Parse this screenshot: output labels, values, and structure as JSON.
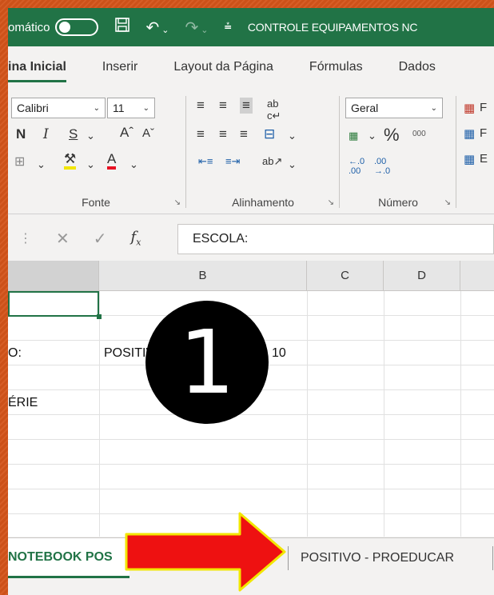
{
  "titlebar": {
    "autosave_label": "omático",
    "doc_title": "CONTROLE EQUIPAMENTOS NC"
  },
  "tabs": [
    "ina Inicial",
    "Inserir",
    "Layout da Página",
    "Fórmulas",
    "Dados"
  ],
  "ribbon": {
    "font_name": "Calibri",
    "font_size": "11",
    "number_format": "Geral",
    "groups": {
      "font": "Fonte",
      "alignment": "Alinhamento",
      "number": "Número"
    },
    "styles_letters": [
      "F",
      "F",
      "E"
    ]
  },
  "formula_bar": {
    "value": "ESCOLA:"
  },
  "grid": {
    "columns": [
      "",
      "B",
      "C",
      "D",
      ""
    ],
    "cells": {
      "a3": "O:",
      "b3": "POSITIV",
      "b3_tail": "10",
      "a5": "ÉRIE"
    }
  },
  "sheets": {
    "active": "NOTEBOOK POS",
    "other": "POSITIVO - PROEDUCAR"
  },
  "overlay": {
    "step_number": "1",
    "arrow_color": "#ee1111"
  }
}
